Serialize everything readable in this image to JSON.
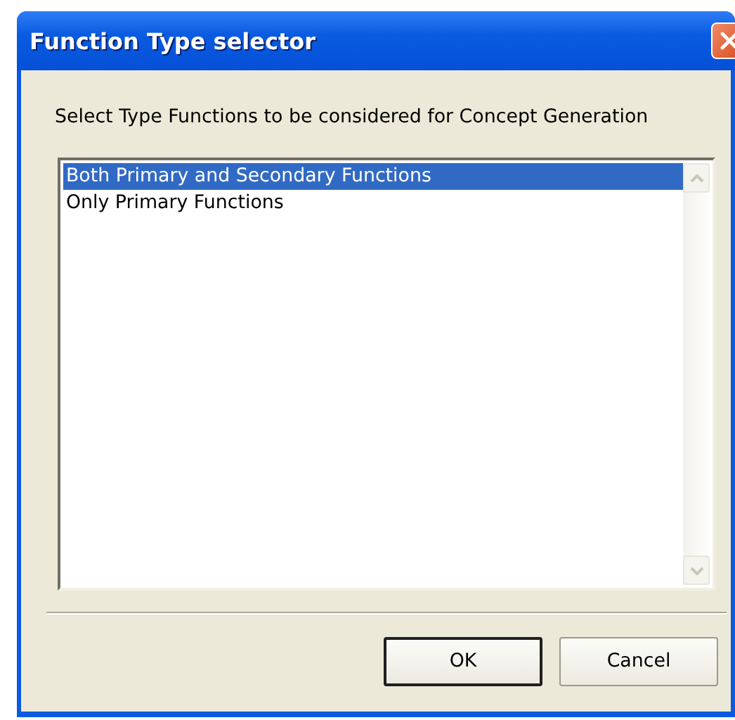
{
  "window": {
    "title": "Function Type selector"
  },
  "prompt": "Select Type Functions to be considered for Concept Generation",
  "list": {
    "items": [
      {
        "label": "Both Primary and Secondary Functions",
        "selected": true
      },
      {
        "label": "Only Primary Functions",
        "selected": false
      }
    ]
  },
  "buttons": [
    {
      "label": "OK",
      "default": true
    },
    {
      "label": "Cancel",
      "default": false
    }
  ]
}
